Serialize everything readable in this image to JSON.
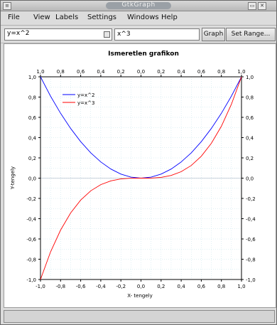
{
  "window": {
    "title": "GtkGraph"
  },
  "menubar": {
    "items": [
      "File",
      "View",
      "Labels",
      "Settings",
      "Windows",
      "Help"
    ]
  },
  "toolbar": {
    "function_selected": "y=x^2",
    "expression_value": "x^3",
    "graph_button": "Graph",
    "set_range_button": "Set Range..."
  },
  "statusbar": {
    "text": ""
  },
  "chart_data": {
    "type": "line",
    "title": "Ismeretlen grafikon",
    "xlabel": "X- tengely",
    "ylabel": "Y-tengely",
    "xlim": [
      -1.0,
      1.0
    ],
    "ylim": [
      -1.0,
      1.0
    ],
    "grid": true,
    "legend_position": "top-left",
    "x_ticks": [
      "-1,0",
      "-0,8",
      "-0,6",
      "-0,4",
      "-0,2",
      "0,0",
      "0,2",
      "0,4",
      "0,6",
      "0,8",
      "1,0"
    ],
    "y_ticks": [
      "-1,0",
      "-0,8",
      "-0,6",
      "-0,4",
      "-0,2",
      "0,0",
      "0,2",
      "0,4",
      "0,6",
      "0,8",
      "1,0"
    ],
    "top_ticks": [
      "1,0",
      "0,8",
      "0,6",
      "0,4",
      "0,2",
      "0,0",
      "0,2",
      "0,4",
      "0,6",
      "0,8",
      "1,0"
    ],
    "right_ticks": [
      "1,0",
      "0,8",
      "0,6",
      "0,4",
      "0,2",
      "0,0",
      "-0,2",
      "-0,4",
      "-0,6",
      "-0,8",
      "-1,0"
    ],
    "series": [
      {
        "name": "y=x^2",
        "color": "#0000ff",
        "x": [
          -1.0,
          -0.9,
          -0.8,
          -0.7,
          -0.6,
          -0.5,
          -0.4,
          -0.3,
          -0.2,
          -0.1,
          0.0,
          0.1,
          0.2,
          0.3,
          0.4,
          0.5,
          0.6,
          0.7,
          0.8,
          0.9,
          1.0
        ],
        "y": [
          1.0,
          0.81,
          0.64,
          0.49,
          0.36,
          0.25,
          0.16,
          0.09,
          0.04,
          0.01,
          0.0,
          0.01,
          0.04,
          0.09,
          0.16,
          0.25,
          0.36,
          0.49,
          0.64,
          0.81,
          1.0
        ]
      },
      {
        "name": "y=x^3",
        "color": "#ff0000",
        "x": [
          -1.0,
          -0.9,
          -0.8,
          -0.7,
          -0.6,
          -0.5,
          -0.4,
          -0.3,
          -0.2,
          -0.1,
          0.0,
          0.1,
          0.2,
          0.3,
          0.4,
          0.5,
          0.6,
          0.7,
          0.8,
          0.9,
          1.0
        ],
        "y": [
          -1.0,
          -0.729,
          -0.512,
          -0.343,
          -0.216,
          -0.125,
          -0.064,
          -0.027,
          -0.008,
          -0.001,
          0.0,
          0.001,
          0.008,
          0.027,
          0.064,
          0.125,
          0.216,
          0.343,
          0.512,
          0.729,
          1.0
        ]
      }
    ]
  }
}
